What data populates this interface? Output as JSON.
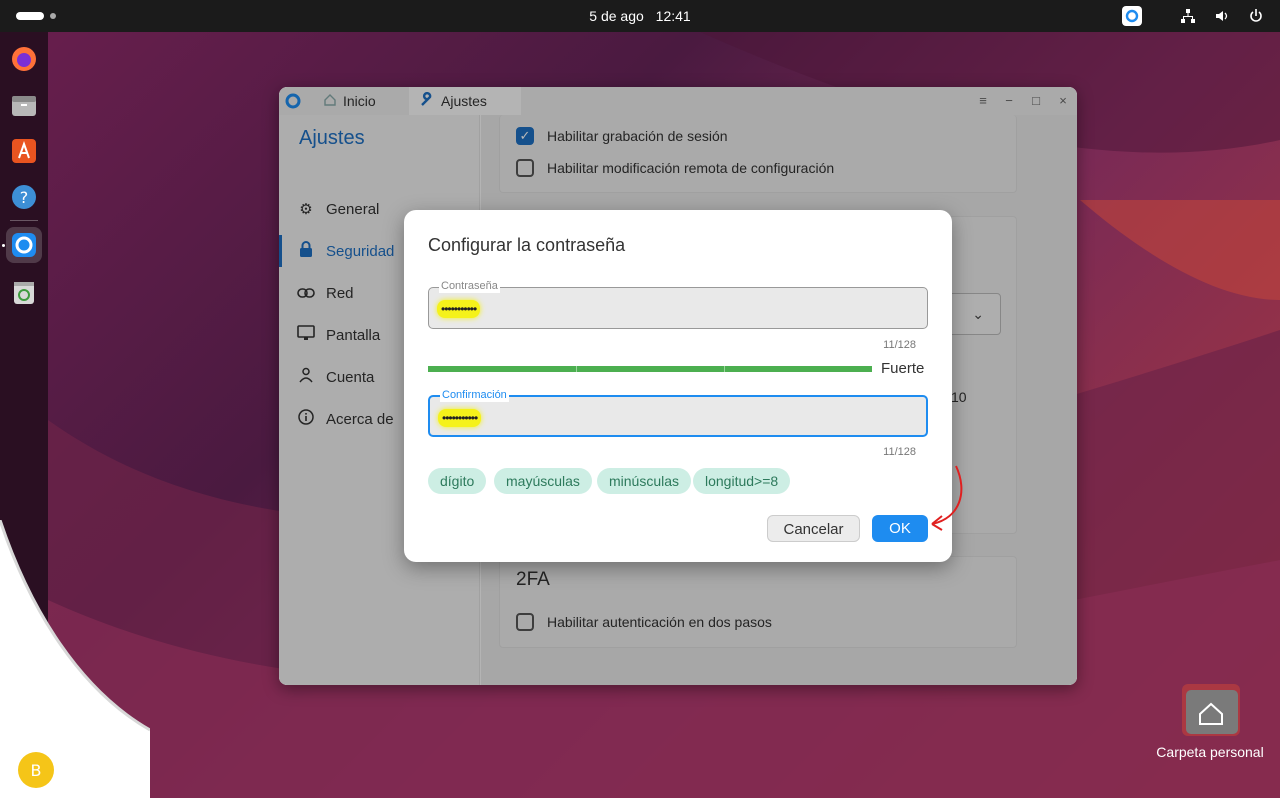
{
  "topbar": {
    "date": "5 de ago",
    "time": "12:41"
  },
  "desktop": {
    "home_label": "Carpeta personal"
  },
  "window": {
    "tabs": [
      {
        "label": "Inicio"
      },
      {
        "label": "Ajustes"
      }
    ],
    "sidebar": {
      "title": "Ajustes",
      "items": [
        {
          "label": "General",
          "icon": "gear-icon"
        },
        {
          "label": "Seguridad",
          "icon": "lock-icon"
        },
        {
          "label": "Red",
          "icon": "link-icon"
        },
        {
          "label": "Pantalla",
          "icon": "monitor-icon"
        },
        {
          "label": "Cuenta",
          "icon": "person-icon"
        },
        {
          "label": "Acerca de",
          "icon": "info-icon"
        }
      ],
      "active_index": 1
    },
    "content": {
      "session_recording_label": "Habilitar grabación de sesión",
      "session_recording_checked": true,
      "remote_config_label": "Habilitar modificación remota de configuración",
      "remote_config_checked": false,
      "partial_value": "10",
      "twofa_title": "2FA",
      "twofa_label": "Habilitar autenticación en dos pasos",
      "twofa_checked": false
    }
  },
  "dialog": {
    "title": "Configurar la contraseña",
    "password": {
      "label": "Contraseña",
      "value": "•••••••••••",
      "counter": "11/128"
    },
    "strength": {
      "label": "Fuerte",
      "color": "#4caf50"
    },
    "confirmation": {
      "label": "Confirmación",
      "value": "•••••••••••",
      "counter": "11/128"
    },
    "chips": [
      "dígito",
      "mayúsculas",
      "minúsculas",
      "longitud>=8"
    ],
    "cancel_label": "Cancelar",
    "ok_label": "OK"
  },
  "colors": {
    "accent": "#1e6fc2",
    "ok_button": "#1e8cf0",
    "highlight": "#f5f21a",
    "chip_bg": "#cdeee4",
    "annotation_arrow": "#e02020"
  }
}
